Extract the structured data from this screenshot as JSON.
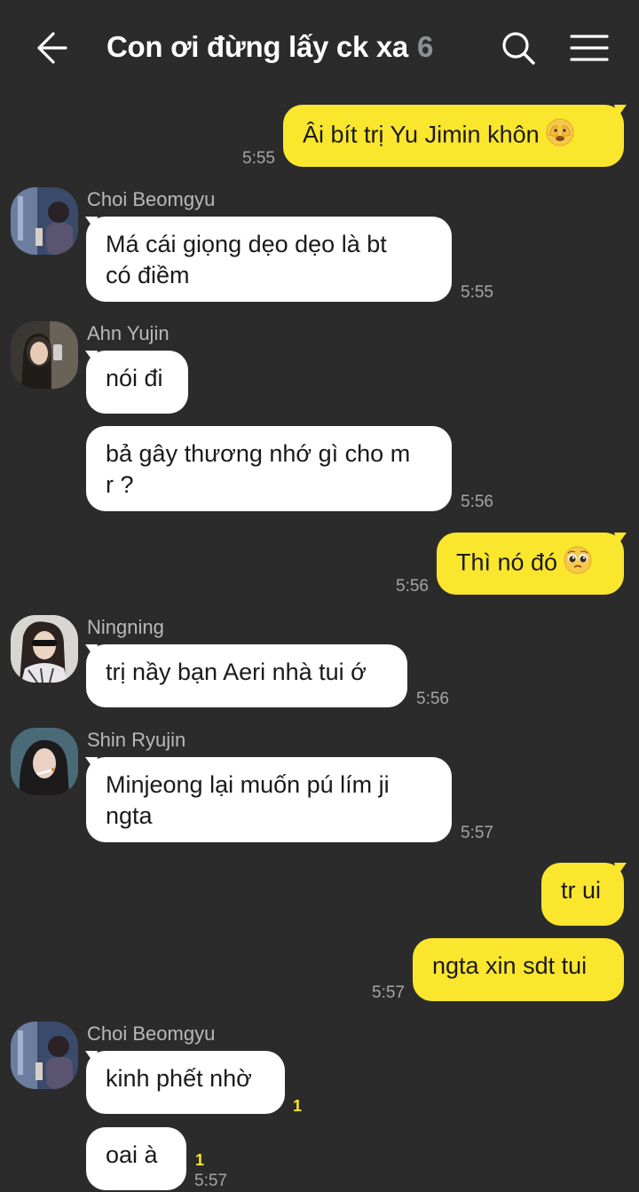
{
  "header": {
    "title": "Con ơi đừng lấy ck xa",
    "member_count": "6",
    "back_icon": "arrow-left-icon",
    "search_icon": "search-icon",
    "menu_icon": "hamburger-menu-icon"
  },
  "colors": {
    "background": "#2b2b2b",
    "my_bubble": "#fbe62e",
    "their_bubble": "#ffffff",
    "unread": "#fbe62e"
  },
  "messages": [
    {
      "from": "me",
      "text": "Âi bít trị Yu Jimin khôn",
      "emoji": "face-peeking-eye-icon",
      "time": "5:55"
    },
    {
      "from": "Choi Beomgyu",
      "text": "Má cái giọng dẹo dẹo là bt\ncó điềm",
      "time": "5:55"
    },
    {
      "from": "Ahn Yujin",
      "text": "nói đi"
    },
    {
      "from": "Ahn Yujin",
      "text": "bả gây thương nhớ gì cho m\nr ?",
      "time": "5:56"
    },
    {
      "from": "me",
      "text": "Thì nó đó",
      "emoji": "pleading-face-icon",
      "time": "5:56"
    },
    {
      "from": "Ningning",
      "text": "trị nầy bạn Aeri nhà tui ớ",
      "time": "5:56"
    },
    {
      "from": "Shin Ryujin",
      "text": "Minjeong lại muốn pú lím ji\nngta",
      "time": "5:57"
    },
    {
      "from": "me",
      "text": "tr ui"
    },
    {
      "from": "me",
      "text": "ngta xin sdt tui",
      "time": "5:57"
    },
    {
      "from": "Choi Beomgyu",
      "text": "kinh phết nhờ",
      "unread": "1"
    },
    {
      "from": "Choi Beomgyu",
      "text": "oai à",
      "unread": "1",
      "time": "5:57"
    }
  ]
}
